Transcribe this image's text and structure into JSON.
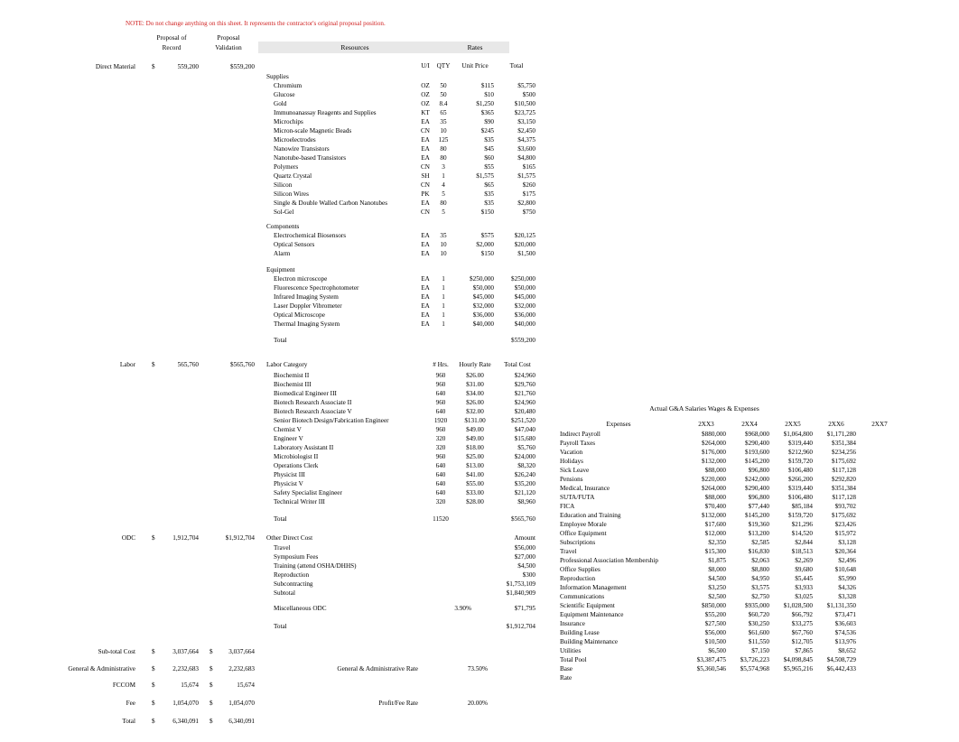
{
  "note": "NOTE: Do not change anything on this sheet. It represents the contractor's original proposal position.",
  "note_color": "#d02020",
  "band_color": "#e8e8e8",
  "headers": {
    "proposal_of_record": [
      "Proposal of",
      "Record"
    ],
    "proposal_validation": [
      "Proposal",
      "Validation"
    ],
    "resources": "Resources",
    "rates": "Rates",
    "ui": "U/I",
    "qty": "QTY",
    "unit_price": "Unit Price",
    "total": "Total",
    "amount": "Amount"
  },
  "cost_lines": [
    {
      "label": "Direct Material",
      "dollar": "$",
      "record": "559,200",
      "validation": "$559,200"
    },
    {
      "label": "Labor",
      "dollar": "$",
      "record": "565,760",
      "validation": "$565,760"
    },
    {
      "label": "ODC",
      "dollar": "$",
      "record": "1,912,704",
      "validation": "$1,912,704"
    },
    {
      "label": "Sub-total Cost",
      "dollar": "$",
      "record": "3,037,664",
      "validation_dollar": "$",
      "validation": "3,037,664"
    },
    {
      "label": "General & Administrative",
      "dollar": "$",
      "record": "2,232,683",
      "validation_dollar": "$",
      "validation": "2,232,683"
    },
    {
      "label": "FCCOM",
      "dollar": "$",
      "record": "15,674",
      "validation_dollar": "$",
      "validation": "15,674"
    },
    {
      "label": "Fee",
      "dollar": "$",
      "record": "1,054,070",
      "validation_dollar": "$",
      "validation": "1,054,070"
    },
    {
      "label": "Total",
      "dollar": "$",
      "record": "6,340,091",
      "validation_dollar": "$",
      "validation": "6,340,091"
    }
  ],
  "materials": {
    "supplies_header": "Supplies",
    "supplies": [
      {
        "name": "Chromium",
        "ui": "OZ",
        "qty": "50",
        "unit_price": "$115",
        "total": "$5,750"
      },
      {
        "name": "Glucose",
        "ui": "OZ",
        "qty": "50",
        "unit_price": "$10",
        "total": "$500"
      },
      {
        "name": "Gold",
        "ui": "OZ",
        "qty": "8.4",
        "unit_price": "$1,250",
        "total": "$10,500"
      },
      {
        "name": "Immunoanassay Reagents and Supplies",
        "ui": "KT",
        "qty": "65",
        "unit_price": "$365",
        "total": "$23,725"
      },
      {
        "name": "Microchips",
        "ui": "EA",
        "qty": "35",
        "unit_price": "$90",
        "total": "$3,150"
      },
      {
        "name": "Micron-scale Magnetic Beads",
        "ui": "CN",
        "qty": "10",
        "unit_price": "$245",
        "total": "$2,450"
      },
      {
        "name": "Microelectrodes",
        "ui": "EA",
        "qty": "125",
        "unit_price": "$35",
        "total": "$4,375"
      },
      {
        "name": "Nanowire Transistors",
        "ui": "EA",
        "qty": "80",
        "unit_price": "$45",
        "total": "$3,600"
      },
      {
        "name": "Nanotube-based Transistors",
        "ui": "EA",
        "qty": "80",
        "unit_price": "$60",
        "total": "$4,800"
      },
      {
        "name": "Polymers",
        "ui": "CN",
        "qty": "3",
        "unit_price": "$55",
        "total": "$165"
      },
      {
        "name": "Quartz Crystal",
        "ui": "SH",
        "qty": "1",
        "unit_price": "$1,575",
        "total": "$1,575"
      },
      {
        "name": "Silicon",
        "ui": "CN",
        "qty": "4",
        "unit_price": "$65",
        "total": "$260"
      },
      {
        "name": "Silicon Wires",
        "ui": "PK",
        "qty": "5",
        "unit_price": "$35",
        "total": "$175"
      },
      {
        "name": "Single & Double Walled Carbon Nanotubes",
        "ui": "EA",
        "qty": "80",
        "unit_price": "$35",
        "total": "$2,800"
      },
      {
        "name": "Sol-Gel",
        "ui": "CN",
        "qty": "5",
        "unit_price": "$150",
        "total": "$750"
      }
    ],
    "components_header": "Components",
    "components": [
      {
        "name": "Electrochemical Biosensors",
        "ui": "EA",
        "qty": "35",
        "unit_price": "$575",
        "total": "$20,125"
      },
      {
        "name": "Optical Sensors",
        "ui": "EA",
        "qty": "10",
        "unit_price": "$2,000",
        "total": "$20,000"
      },
      {
        "name": "Alarm",
        "ui": "EA",
        "qty": "10",
        "unit_price": "$150",
        "total": "$1,500"
      }
    ],
    "equipment_header": "Equipment",
    "equipment": [
      {
        "name": "Electron microscope",
        "ui": "EA",
        "qty": "1",
        "unit_price": "$250,000",
        "total": "$250,000"
      },
      {
        "name": "Fluorescence Spectrophotometer",
        "ui": "EA",
        "qty": "1",
        "unit_price": "$50,000",
        "total": "$50,000"
      },
      {
        "name": "Infrared Imaging System",
        "ui": "EA",
        "qty": "1",
        "unit_price": "$45,000",
        "total": "$45,000"
      },
      {
        "name": "Laser Doppler Vibrometer",
        "ui": "EA",
        "qty": "1",
        "unit_price": "$32,000",
        "total": "$32,000"
      },
      {
        "name": "Optical Microscope",
        "ui": "EA",
        "qty": "1",
        "unit_price": "$36,000",
        "total": "$36,000"
      },
      {
        "name": "Thermal Imaging System",
        "ui": "EA",
        "qty": "1",
        "unit_price": "$40,000",
        "total": "$40,000"
      }
    ],
    "total_label": "Total",
    "total_value": "$559,200"
  },
  "labor": {
    "header": "Labor Category",
    "col_hrs": "# Hrs.",
    "col_rate": "Hourly Rate",
    "col_cost": "Total Cost",
    "rows": [
      {
        "name": "Biochemist II",
        "hrs": "960",
        "rate": "$26.00",
        "cost": "$24,960"
      },
      {
        "name": "Biochemist III",
        "hrs": "960",
        "rate": "$31.00",
        "cost": "$29,760"
      },
      {
        "name": "Biomedical Engineer III",
        "hrs": "640",
        "rate": "$34.00",
        "cost": "$21,760"
      },
      {
        "name": "Biotech Research Associate II",
        "hrs": "960",
        "rate": "$26.00",
        "cost": "$24,960"
      },
      {
        "name": "Biotech Research Associate V",
        "hrs": "640",
        "rate": "$32.00",
        "cost": "$20,480"
      },
      {
        "name": "Senior Biotech Design/Fabrication Engineer",
        "hrs": "1920",
        "rate": "$131.00",
        "cost": "$251,520"
      },
      {
        "name": "Chemist V",
        "hrs": "960",
        "rate": "$49.00",
        "cost": "$47,040"
      },
      {
        "name": "Engineer V",
        "hrs": "320",
        "rate": "$49.00",
        "cost": "$15,680"
      },
      {
        "name": "Laboratory Assistant II",
        "hrs": "320",
        "rate": "$18.00",
        "cost": "$5,760"
      },
      {
        "name": "Microbiologist II",
        "hrs": "960",
        "rate": "$25.00",
        "cost": "$24,000"
      },
      {
        "name": "Operations Clerk",
        "hrs": "640",
        "rate": "$13.00",
        "cost": "$8,320"
      },
      {
        "name": "Physicist III",
        "hrs": "640",
        "rate": "$41.00",
        "cost": "$26,240"
      },
      {
        "name": "Physicist V",
        "hrs": "640",
        "rate": "$55.00",
        "cost": "$35,200"
      },
      {
        "name": "Safety Specialist Engineer",
        "hrs": "640",
        "rate": "$33.00",
        "cost": "$21,120"
      },
      {
        "name": "Technical Writer III",
        "hrs": "320",
        "rate": "$28.00",
        "cost": "$8,960"
      }
    ],
    "total_label": "Total",
    "total_hrs": "11520",
    "total_cost": "$565,760"
  },
  "odc": {
    "header": "Other Direct Cost",
    "amount_header": "Amount",
    "rows": [
      {
        "name": "Travel",
        "amount": "$56,000"
      },
      {
        "name": "Symposium Fees",
        "amount": "$27,000"
      },
      {
        "name": "Training (attend OSHA/DHHS)",
        "amount": "$4,500"
      },
      {
        "name": "Reproduction",
        "amount": "$300"
      },
      {
        "name": "Subcontracting",
        "amount": "$1,753,109"
      },
      {
        "name": "Subtotal",
        "amount": "$1,840,909"
      }
    ],
    "misc_label": "Miscellaneous ODC",
    "misc_pct": "3.90%",
    "misc_amount": "$71,795",
    "total_label": "Total",
    "total_amount": "$1,912,704"
  },
  "rates": {
    "ga_label": "General & Administrative Rate",
    "ga_value": "73.50%",
    "fee_label": "Profit/Fee Rate",
    "fee_value": "20.00%"
  },
  "ga_table": {
    "title": "Actual G&A Salaries Wages & Expenses",
    "col_expenses": "Expenses",
    "years": [
      "2XX3",
      "2XX4",
      "2XX5",
      "2XX6",
      "2XX7"
    ],
    "rows": [
      {
        "name": "Indirect Payroll",
        "v": [
          "$880,000",
          "$968,000",
          "$1,064,800",
          "$1,171,280",
          ""
        ]
      },
      {
        "name": "Payroll Taxes",
        "v": [
          "$264,000",
          "$290,400",
          "$319,440",
          "$351,384",
          ""
        ]
      },
      {
        "name": "Vacation",
        "v": [
          "$176,000",
          "$193,600",
          "$212,960",
          "$234,256",
          ""
        ]
      },
      {
        "name": "Holidays",
        "v": [
          "$132,000",
          "$145,200",
          "$159,720",
          "$175,692",
          ""
        ]
      },
      {
        "name": "Sick Leave",
        "v": [
          "$88,000",
          "$96,800",
          "$106,480",
          "$117,128",
          ""
        ]
      },
      {
        "name": "Pensions",
        "v": [
          "$220,000",
          "$242,000",
          "$266,200",
          "$292,820",
          ""
        ]
      },
      {
        "name": "Medical, Insurance",
        "v": [
          "$264,000",
          "$290,400",
          "$319,440",
          "$351,384",
          ""
        ]
      },
      {
        "name": "SUTA/FUTA",
        "v": [
          "$88,000",
          "$96,800",
          "$106,480",
          "$117,128",
          ""
        ]
      },
      {
        "name": "FICA",
        "v": [
          "$70,400",
          "$77,440",
          "$85,184",
          "$93,702",
          ""
        ]
      },
      {
        "name": "Education and Training",
        "v": [
          "$132,000",
          "$145,200",
          "$159,720",
          "$175,692",
          ""
        ]
      },
      {
        "name": "Employee Morale",
        "v": [
          "$17,600",
          "$19,360",
          "$21,296",
          "$23,426",
          ""
        ]
      },
      {
        "name": "Office Equipment",
        "v": [
          "$12,000",
          "$13,200",
          "$14,520",
          "$15,972",
          ""
        ]
      },
      {
        "name": "Subscriptions",
        "v": [
          "$2,350",
          "$2,585",
          "$2,844",
          "$3,128",
          ""
        ]
      },
      {
        "name": "Travel",
        "v": [
          "$15,300",
          "$16,830",
          "$18,513",
          "$20,364",
          ""
        ]
      },
      {
        "name": "Professional Association Membership",
        "v": [
          "$1,875",
          "$2,063",
          "$2,269",
          "$2,496",
          ""
        ]
      },
      {
        "name": "Office Supplies",
        "v": [
          "$8,000",
          "$8,800",
          "$9,680",
          "$10,648",
          ""
        ]
      },
      {
        "name": "Reproduction",
        "v": [
          "$4,500",
          "$4,950",
          "$5,445",
          "$5,990",
          ""
        ]
      },
      {
        "name": "Information Management",
        "v": [
          "$3,250",
          "$3,575",
          "$3,933",
          "$4,326",
          ""
        ]
      },
      {
        "name": "Communications",
        "v": [
          "$2,500",
          "$2,750",
          "$3,025",
          "$3,328",
          ""
        ]
      },
      {
        "name": "Scientific Equipment",
        "v": [
          "$850,000",
          "$935,000",
          "$1,028,500",
          "$1,131,350",
          ""
        ]
      },
      {
        "name": "Equipment Maintenance",
        "v": [
          "$55,200",
          "$60,720",
          "$66,792",
          "$73,471",
          ""
        ]
      },
      {
        "name": "Insurance",
        "v": [
          "$27,500",
          "$30,250",
          "$33,275",
          "$36,603",
          ""
        ]
      },
      {
        "name": "Building Lease",
        "v": [
          "$56,000",
          "$61,600",
          "$67,760",
          "$74,536",
          ""
        ]
      },
      {
        "name": "Building Maintenance",
        "v": [
          "$10,500",
          "$11,550",
          "$12,705",
          "$13,976",
          ""
        ]
      },
      {
        "name": "Utilities",
        "v": [
          "$6,500",
          "$7,150",
          "$7,865",
          "$8,652",
          ""
        ]
      },
      {
        "name": "Total Pool",
        "v": [
          "$3,387,475",
          "$3,726,223",
          "$4,098,845",
          "$4,508,729",
          ""
        ]
      },
      {
        "name": "Base",
        "v": [
          "$5,360,546",
          "$5,574,968",
          "$5,965,216",
          "$6,442,433",
          ""
        ]
      },
      {
        "name": "Rate",
        "v": [
          "",
          "",
          "",
          "",
          ""
        ]
      }
    ]
  }
}
